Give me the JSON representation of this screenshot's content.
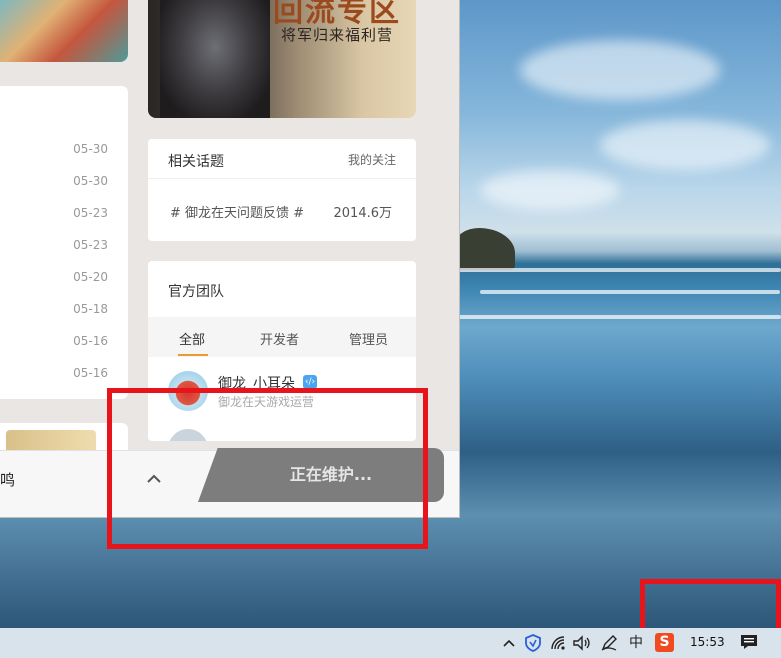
{
  "banner": {
    "title": "回流专区",
    "subtitle": "将军归来福利营"
  },
  "list": {
    "dates": [
      "05-30",
      "05-30",
      "05-23",
      "05-23",
      "05-20",
      "05-18",
      "05-16",
      "05-16"
    ]
  },
  "topics": {
    "title": "相关话题",
    "my_follow": "我的关注",
    "items": [
      {
        "name": "# 御龙在天问题反馈 #",
        "count": "2014.6万"
      }
    ]
  },
  "team": {
    "title": "官方团队",
    "tabs": [
      "全部",
      "开发者",
      "管理员"
    ],
    "active_tab": "全部",
    "members": [
      {
        "name": "御龙_小耳朵",
        "role": "御龙在天游戏运营",
        "badge": "‹/›"
      }
    ]
  },
  "bottom_bar": {
    "text": "鸣",
    "maintenance_label": "正在维护..."
  },
  "taskbar": {
    "ime_label": "中",
    "sogou_label": "S",
    "time": "15:53"
  },
  "colors": {
    "accent": "#e89b2f",
    "highlight": "#e8141c",
    "verified": "#4aa4f0",
    "maintenance_bg": "#7d7d7d"
  }
}
